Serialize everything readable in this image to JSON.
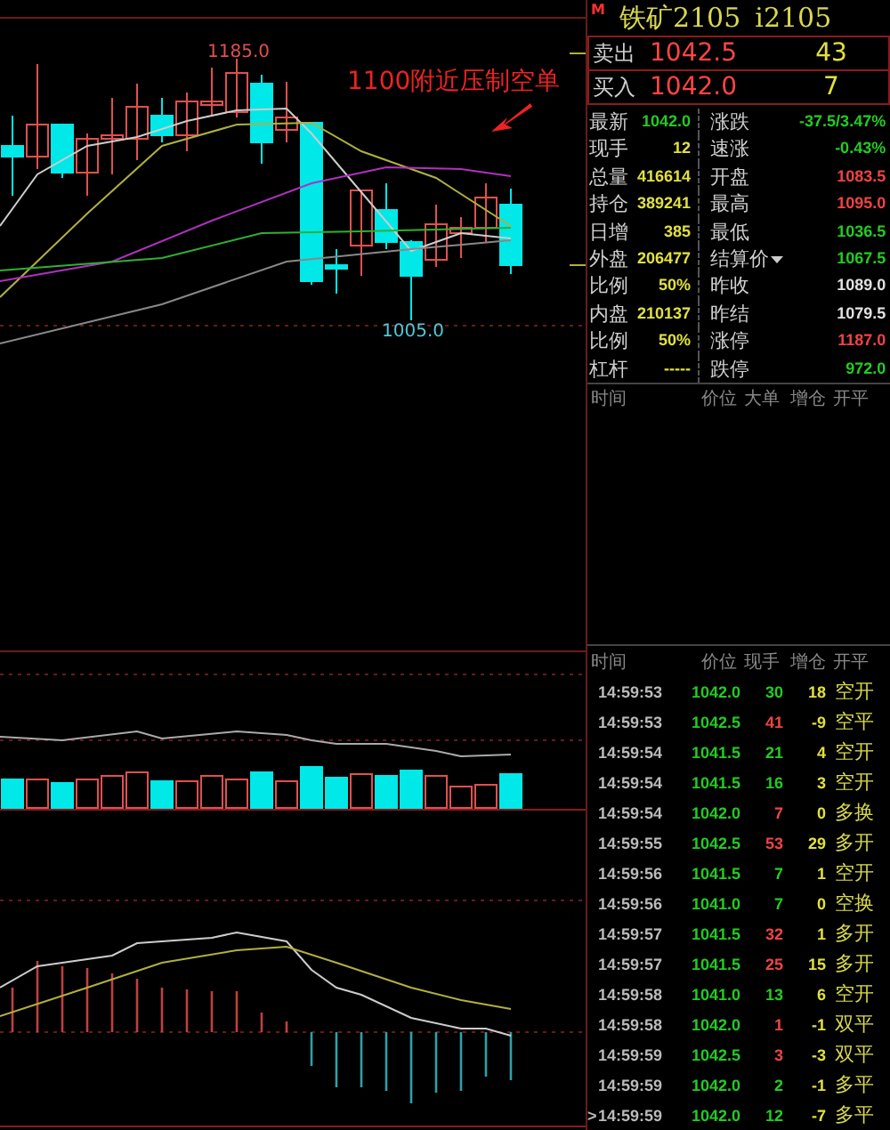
{
  "chart": {
    "high_label": "1185.0",
    "low_label": "1005.0",
    "annotation": "1100附近压制空单"
  },
  "quote": {
    "badge": "M",
    "name": "铁矿2105",
    "code": "i2105",
    "orders": [
      {
        "label": "卖出",
        "price": "1042.5",
        "volume": "43"
      },
      {
        "label": "买入",
        "price": "1042.0",
        "volume": "7"
      }
    ]
  },
  "stats": [
    {
      "label": "最新",
      "value": "1042.0",
      "color": "#22cc22"
    },
    {
      "label": "涨跌",
      "value": "-37.5/3.47%",
      "color": "#22cc22"
    },
    {
      "label": "现手",
      "value": "12",
      "color": "#e0e040"
    },
    {
      "label": "速涨",
      "value": "-0.43%",
      "color": "#22cc22"
    },
    {
      "label": "总量",
      "value": "416614",
      "color": "#e0e040"
    },
    {
      "label": "开盘",
      "value": "1083.5",
      "color": "#ee4444"
    },
    {
      "label": "持仓",
      "value": "389241",
      "color": "#e0e040"
    },
    {
      "label": "最高",
      "value": "1095.0",
      "color": "#ee4444"
    },
    {
      "label": "日增",
      "value": "385",
      "color": "#e0e040"
    },
    {
      "label": "最低",
      "value": "1036.5",
      "color": "#22cc22"
    },
    {
      "label": "外盘",
      "value": "206477",
      "color": "#e0e040"
    },
    {
      "label": "结算价",
      "value": "1067.5",
      "color": "#22cc22",
      "dropdown": true
    },
    {
      "label": "比例",
      "value": "50%",
      "color": "#e0e040"
    },
    {
      "label": "昨收",
      "value": "1089.0",
      "color": "#e0e0e0"
    },
    {
      "label": "内盘",
      "value": "210137",
      "color": "#e0e040"
    },
    {
      "label": "昨结",
      "value": "1079.5",
      "color": "#e0e0e0"
    },
    {
      "label": "比例",
      "value": "50%",
      "color": "#e0e040"
    },
    {
      "label": "涨停",
      "value": "1187.0",
      "color": "#ee4444"
    },
    {
      "label": "杠杆",
      "value": "-----",
      "color": "#e0e040"
    },
    {
      "label": "跌停",
      "value": "972.0",
      "color": "#22cc22"
    }
  ],
  "big_orders": {
    "columns": [
      "时间",
      "价位",
      "大单",
      "增仓",
      "开平"
    ]
  },
  "trades": {
    "columns": [
      "时间",
      "价位",
      "现手",
      "增仓",
      "开平"
    ],
    "rows": [
      {
        "time": "14:59:53",
        "price": "1042.0",
        "volume": "30",
        "color": "#22cc22",
        "change": "18",
        "type": "空开"
      },
      {
        "time": "14:59:53",
        "price": "1042.5",
        "volume": "41",
        "color": "#ee4444",
        "change": "-9",
        "type": "空平"
      },
      {
        "time": "14:59:54",
        "price": "1041.5",
        "volume": "21",
        "color": "#22cc22",
        "change": "4",
        "type": "空开"
      },
      {
        "time": "14:59:54",
        "price": "1041.5",
        "volume": "16",
        "color": "#22cc22",
        "change": "3",
        "type": "空开"
      },
      {
        "time": "14:59:54",
        "price": "1042.0",
        "volume": "7",
        "color": "#ee4444",
        "change": "0",
        "type": "多换"
      },
      {
        "time": "14:59:55",
        "price": "1042.5",
        "volume": "53",
        "color": "#ee4444",
        "change": "29",
        "type": "多开"
      },
      {
        "time": "14:59:56",
        "price": "1041.5",
        "volume": "7",
        "color": "#22cc22",
        "change": "1",
        "type": "空开"
      },
      {
        "time": "14:59:56",
        "price": "1041.0",
        "volume": "7",
        "color": "#22cc22",
        "change": "0",
        "type": "空换"
      },
      {
        "time": "14:59:57",
        "price": "1041.5",
        "volume": "32",
        "color": "#ee4444",
        "change": "1",
        "type": "多开"
      },
      {
        "time": "14:59:57",
        "price": "1041.5",
        "volume": "25",
        "color": "#ee4444",
        "change": "15",
        "type": "多开"
      },
      {
        "time": "14:59:58",
        "price": "1041.0",
        "volume": "13",
        "color": "#22cc22",
        "change": "6",
        "type": "空开"
      },
      {
        "time": "14:59:58",
        "price": "1042.0",
        "volume": "1",
        "color": "#ee4444",
        "change": "-1",
        "type": "双平"
      },
      {
        "time": "14:59:59",
        "price": "1042.5",
        "volume": "3",
        "color": "#ee4444",
        "change": "-3",
        "type": "双平"
      },
      {
        "time": "14:59:59",
        "price": "1042.0",
        "volume": "2",
        "color": "#22cc22",
        "change": "-1",
        "type": "多平"
      },
      {
        "time": "14:59:59",
        "price": "1042.0",
        "volume": "12",
        "color": "#22cc22",
        "change": "-7",
        "type": "多平",
        "marker": ">"
      }
    ]
  }
}
